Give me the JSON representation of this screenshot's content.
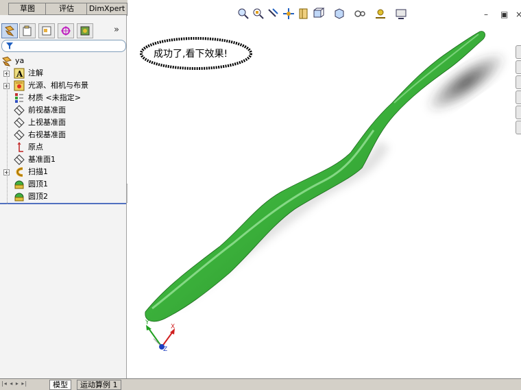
{
  "top_tabs": [
    {
      "label": "草图"
    },
    {
      "label": "评估"
    },
    {
      "label": "DimXpert"
    }
  ],
  "feature_tree": {
    "root": "ya",
    "items": [
      {
        "label": "注解",
        "icon": "annotations-icon",
        "expandable": true
      },
      {
        "label": "光源、相机与布景",
        "icon": "lights-cameras-icon",
        "expandable": true
      },
      {
        "label": "材质 <未指定>",
        "icon": "material-icon",
        "expandable": false
      },
      {
        "label": "前视基准面",
        "icon": "plane-icon",
        "expandable": false
      },
      {
        "label": "上视基准面",
        "icon": "plane-icon",
        "expandable": false
      },
      {
        "label": "右视基准面",
        "icon": "plane-icon",
        "expandable": false
      },
      {
        "label": "原点",
        "icon": "origin-icon",
        "expandable": false
      },
      {
        "label": "基准面1",
        "icon": "plane-icon",
        "expandable": false
      },
      {
        "label": "扫描1",
        "icon": "sweep-icon",
        "expandable": true
      },
      {
        "label": "圆顶1",
        "icon": "dome-icon",
        "expandable": false
      },
      {
        "label": "圆顶2",
        "icon": "dome-icon",
        "expandable": false
      }
    ]
  },
  "callout": {
    "text": "成功了,看下效果!"
  },
  "bottom_tabs": [
    {
      "label": "模型"
    },
    {
      "label": "运动算例 1"
    }
  ],
  "triad": {
    "x": "X",
    "y": "Y",
    "z": "Z"
  },
  "colors": {
    "model_green": "#3db43d",
    "panel_bg": "#f3f3f3",
    "accent": "#6080b0"
  }
}
